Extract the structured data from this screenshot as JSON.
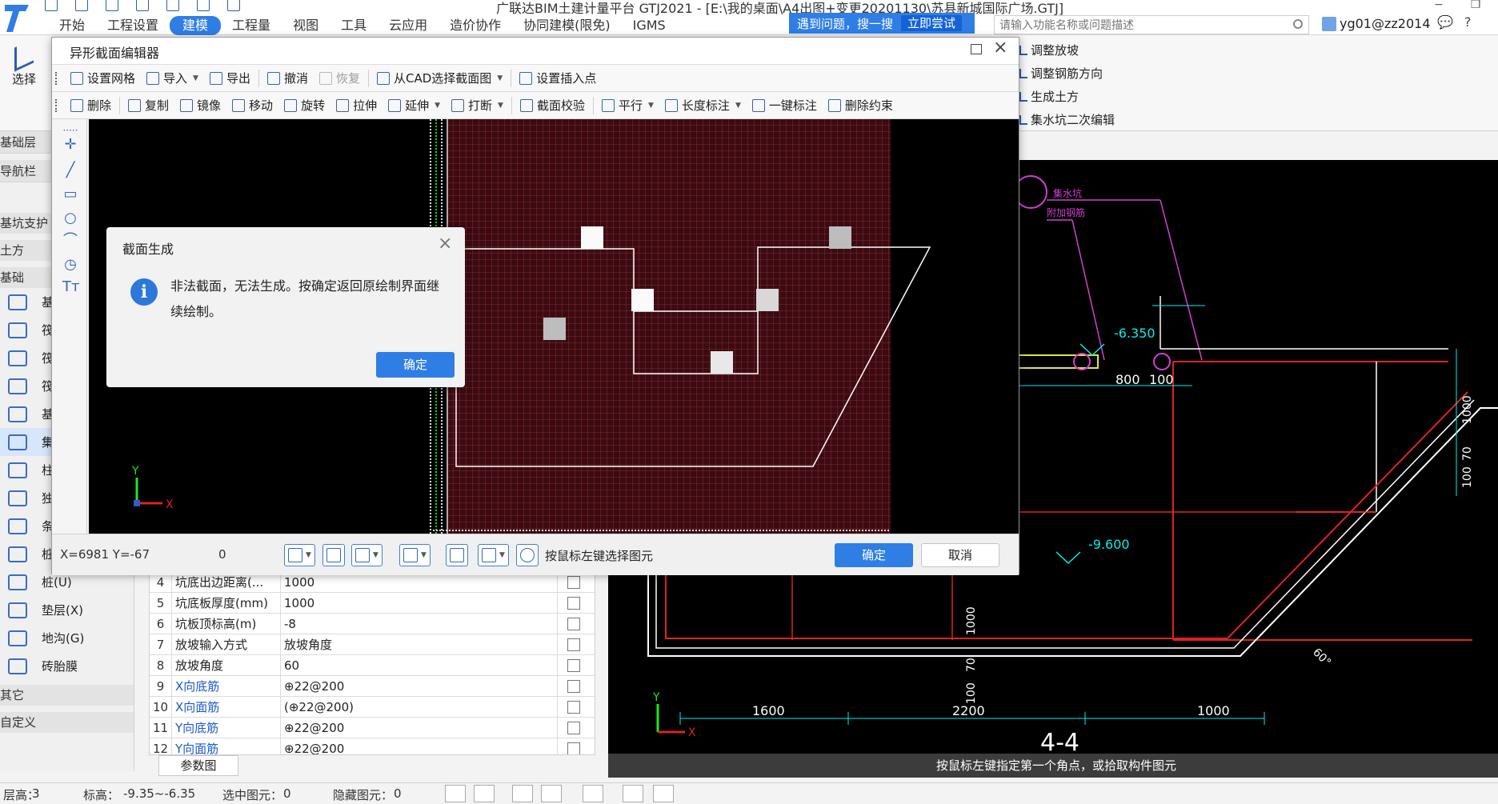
{
  "app": {
    "title": "广联达BIM土建计量平台 GTJ2021 - [E:\\我的桌面\\A4出图+变更20201130\\苏县新城国际广场.GTJ]",
    "menu_tabs": [
      "开始",
      "工程设置",
      "建模",
      "工程量",
      "视图",
      "工具",
      "云应用",
      "造价协作",
      "协同建模(限免)",
      "IGMS"
    ],
    "active_tab": "建模",
    "help_text": "遇到问题，搜一搜",
    "help_button": "立即尝试",
    "search_placeholder": "请输入功能名称或问题描述",
    "user": "yg01@zz2014"
  },
  "ribbon": {
    "select_label": "选择",
    "right_items": [
      "调整放坡",
      "调整钢筋方向",
      "生成土方",
      "集水坑二次编辑"
    ]
  },
  "left_nav": {
    "layer_label": "基础层",
    "nav_header": "导航栏",
    "group_pit": "基坑支护",
    "group_earth": "土方",
    "group_found": "基础",
    "items": [
      "基础",
      "筏板",
      "筏板",
      "筏板",
      "基础",
      "集水",
      "柱墩",
      "独立",
      "条形",
      "桩承台(V)",
      "桩(U)",
      "垫层(X)",
      "地沟(G)",
      "砖胎膜"
    ],
    "group_other": "其它",
    "group_custom": "自定义"
  },
  "props": {
    "rows": [
      {
        "n": "4",
        "k": "坑底出边距离(...",
        "v": "1000",
        "blue": false
      },
      {
        "n": "5",
        "k": "坑底板厚度(mm)",
        "v": "1000",
        "blue": false
      },
      {
        "n": "6",
        "k": "坑板顶标高(m)",
        "v": "-8",
        "blue": false
      },
      {
        "n": "7",
        "k": "放坡输入方式",
        "v": "放坡角度",
        "blue": false
      },
      {
        "n": "8",
        "k": "放坡角度",
        "v": "60",
        "blue": false
      },
      {
        "n": "9",
        "k": "X向底筋",
        "v": "⊕22@200",
        "blue": true
      },
      {
        "n": "10",
        "k": "X向面筋",
        "v": "(⊕22@200)",
        "blue": true
      },
      {
        "n": "11",
        "k": "Y向底筋",
        "v": "⊕22@200",
        "blue": true
      },
      {
        "n": "12",
        "k": "Y向面筋",
        "v": "⊕22@200",
        "blue": true
      }
    ],
    "param_tab": "参数图"
  },
  "editor": {
    "title": "异形截面编辑器",
    "toolbar1": [
      "设置网格",
      "导入",
      "导出",
      "撤消",
      "恢复",
      "从CAD选择截面图",
      "设置插入点"
    ],
    "toolbar2": [
      "删除",
      "复制",
      "镜像",
      "移动",
      "旋转",
      "拉伸",
      "延伸",
      "打断",
      "截面校验",
      "平行",
      "长度标注",
      "一键标注",
      "删除约束"
    ],
    "coord": "X=6981 Y=-67",
    "coord_extra": "0",
    "hint": "按鼠标左键选择图元",
    "ok": "确定",
    "cancel": "取消"
  },
  "message": {
    "title": "截面生成",
    "body": "非法截面，无法生成。按确定返回原绘制界面继续绘制。",
    "ok": "确定"
  },
  "cad": {
    "dims": [
      "-6.350",
      "-9.600",
      "800",
      "100",
      "1600",
      "2200",
      "1000",
      "1000",
      "70",
      "100",
      "1000",
      "70",
      "100",
      "60°"
    ],
    "section": "4-4",
    "status": "按鼠标左键指定第一个角点，或拾取构件图元"
  },
  "status": {
    "floor": "层高：",
    "floor_val": "3",
    "elev": "标高：",
    "elev_val": "-9.35~-6.35",
    "selected": "选中图元：",
    "selected_val": "0",
    "hidden": "隐藏图元：",
    "hidden_val": "0"
  }
}
